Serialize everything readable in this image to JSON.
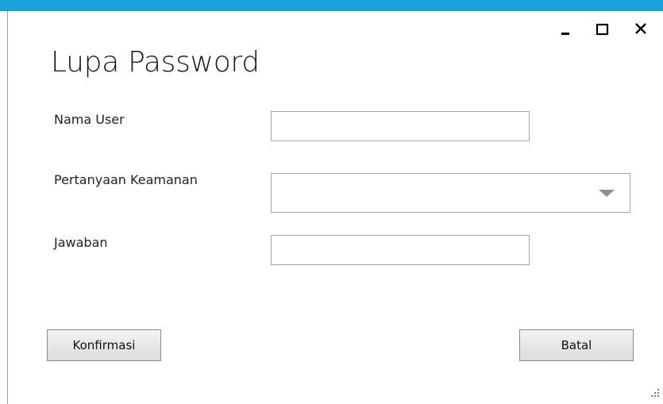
{
  "window": {
    "accent_color": "#1aa3d8",
    "controls": [
      {
        "name": "minimize",
        "icon": "minimize-icon"
      },
      {
        "name": "maximize",
        "icon": "maximize-icon"
      },
      {
        "name": "close",
        "icon": "close-icon"
      }
    ]
  },
  "form": {
    "title": "Lupa Password",
    "fields": {
      "username": {
        "label": "Nama User",
        "value": ""
      },
      "security_question": {
        "label": "Pertanyaan Keamanan",
        "selected": ""
      },
      "answer": {
        "label": "Jawaban",
        "value": ""
      }
    }
  },
  "buttons": {
    "confirm_label": "Konfirmasi",
    "cancel_label": "Batal"
  }
}
